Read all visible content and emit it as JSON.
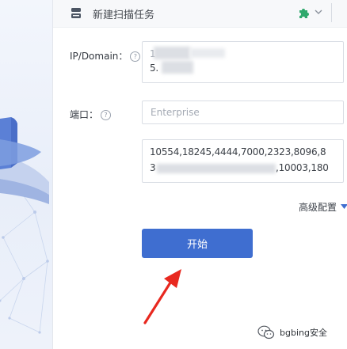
{
  "dialog": {
    "title": "新建扫描任务"
  },
  "form": {
    "ip_domain": {
      "label": "IP/Domain：",
      "help": "?",
      "line1": "1",
      "line2": "5."
    },
    "port": {
      "label": "端口：",
      "help": "?",
      "placeholder": "Enterprise"
    },
    "ports_list": {
      "line1": "10554,18245,4444,7000,2323,8096,8",
      "line2_start": "3",
      "line2_end": ",10003,180"
    },
    "advanced_label": "高级配置",
    "start_label": "开始"
  },
  "watermark": {
    "text": "bgbing安全"
  },
  "colors": {
    "primary": "#3f6ed0",
    "arrow": "#e8281f",
    "border": "#d9dde4"
  },
  "icons": {
    "title": "scanner-icon",
    "plugin": "puzzle-icon",
    "help": "question-circle-icon",
    "dropdown": "chevron-down-icon",
    "watermark": "wechat-icon"
  }
}
